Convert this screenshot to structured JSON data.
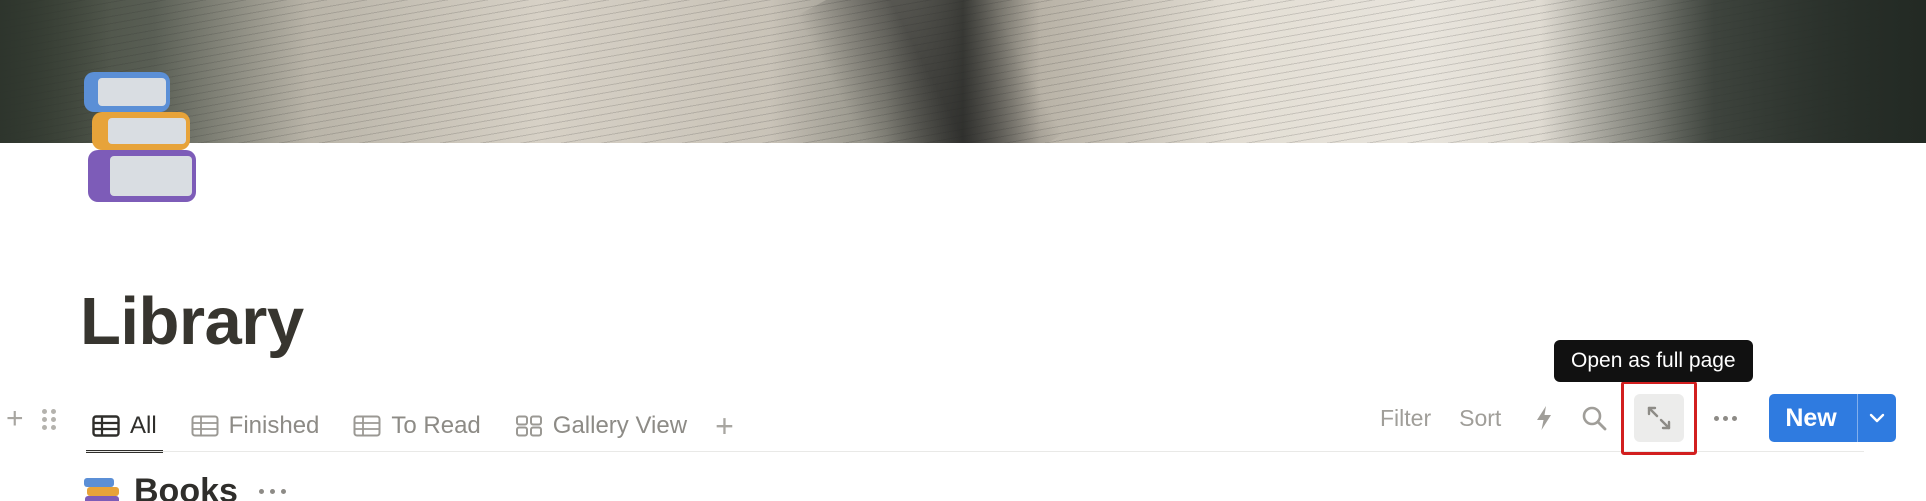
{
  "page": {
    "title": "Library",
    "icon": "stacked-books-icon"
  },
  "views": {
    "tabs": [
      {
        "label": "All",
        "icon": "table-icon",
        "active": true
      },
      {
        "label": "Finished",
        "icon": "table-icon",
        "active": false
      },
      {
        "label": "To Read",
        "icon": "table-icon",
        "active": false
      },
      {
        "label": "Gallery View",
        "icon": "gallery-icon",
        "active": false
      }
    ],
    "add_view_icon": "plus-icon"
  },
  "toolbar": {
    "filter_label": "Filter",
    "sort_label": "Sort",
    "automation_icon": "lightning-icon",
    "search_icon": "search-icon",
    "expand_icon": "expand-arrows-icon",
    "more_icon": "more-dots-icon",
    "new_label": "New",
    "new_dropdown_icon": "chevron-down-icon"
  },
  "tooltip": {
    "text": "Open as full page"
  },
  "section": {
    "title": "Books"
  },
  "colors": {
    "accent": "#2f7be0",
    "highlight_border": "#d21f1f",
    "text": "#37352f",
    "muted": "#a09e99"
  }
}
